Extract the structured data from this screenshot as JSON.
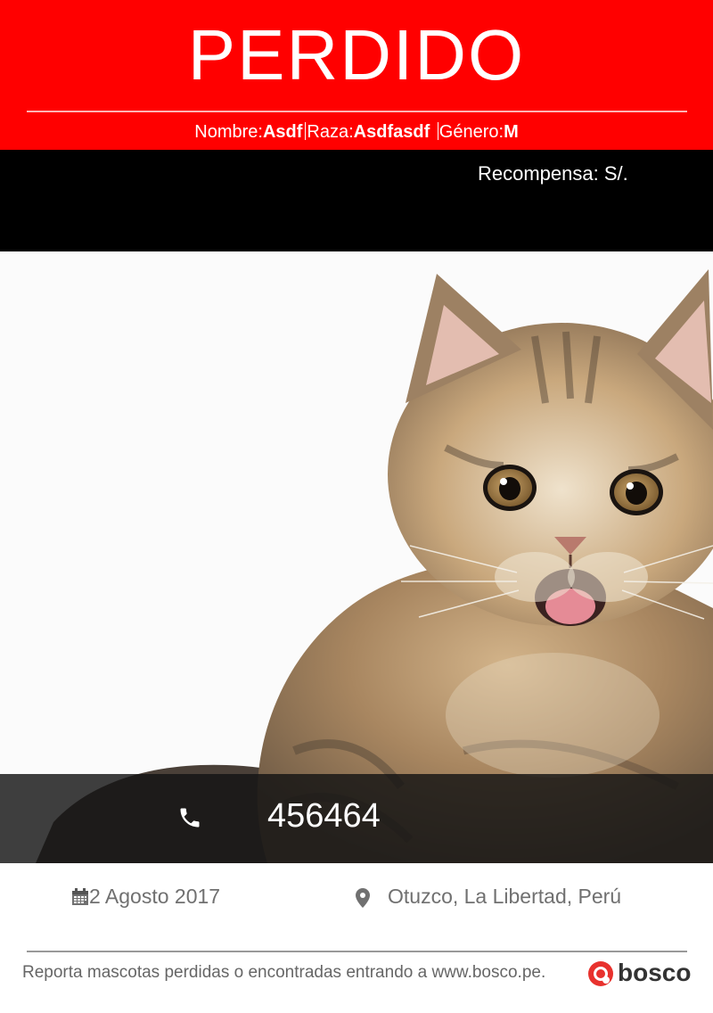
{
  "poster": {
    "status_title": "PERDIDO",
    "pet": {
      "name_label": "Nombre:",
      "name_value": "Asdf",
      "breed_label": "Raza:",
      "breed_value": "Asdfasdf",
      "gender_label": "Género:",
      "gender_value": "M"
    },
    "reward_text": "Recompensa: S/.",
    "photo_icon": "kitten-photo",
    "contact": {
      "icon": "phone-icon",
      "phone": "456464"
    },
    "date": {
      "icon": "calendar-icon",
      "text": "2 Agosto 2017"
    },
    "location": {
      "icon": "location-pin-icon",
      "text": "Otuzco, La Libertad, Perú"
    },
    "footer_text": "Reporta mascotas perdidas o encontradas entrando a www.bosco.pe.",
    "logo_text": "bosco"
  },
  "colors": {
    "header_red": "#ff0000",
    "reward_bar": "#000000",
    "phone_bar": "#1a1a1a",
    "muted_text": "#707070",
    "logo_red": "#e8322e"
  }
}
